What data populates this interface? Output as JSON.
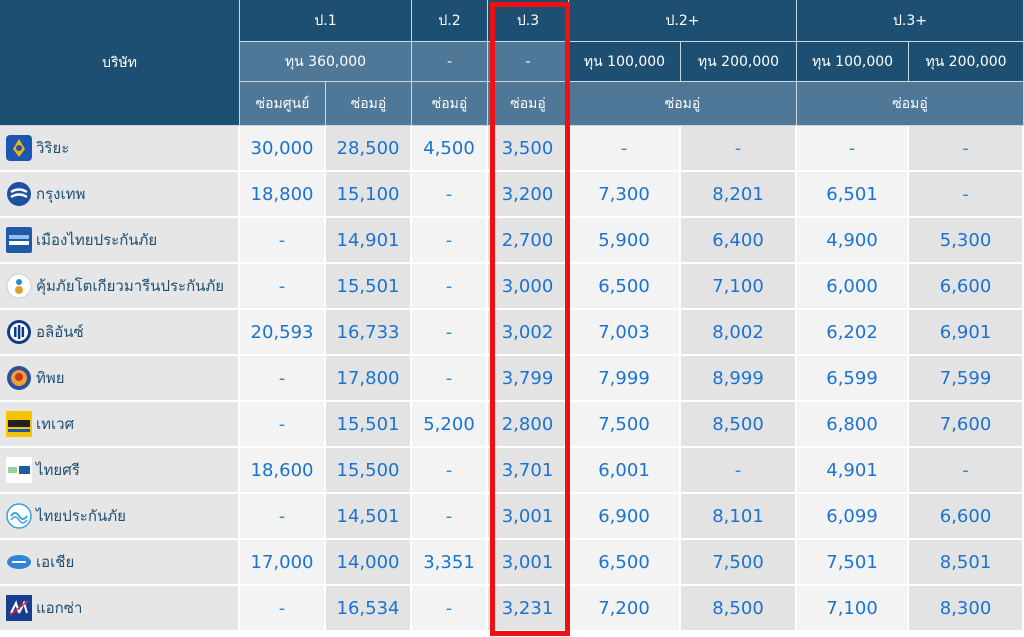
{
  "header": {
    "company_label": "บริษัท",
    "groups": [
      {
        "label": "ป.1",
        "span": 2
      },
      {
        "label": "ป.2",
        "span": 1
      },
      {
        "label": "ป.3",
        "span": 1
      },
      {
        "label": "ป.2+",
        "span": 2
      },
      {
        "label": "ป.3+",
        "span": 2
      }
    ],
    "sums": [
      {
        "label": "ทุน 360,000",
        "span": 2
      },
      {
        "label": "-",
        "span": 1
      },
      {
        "label": "-",
        "span": 1
      },
      {
        "label": "ทุน 100,000",
        "span": 1
      },
      {
        "label": "ทุน 200,000",
        "span": 1
      },
      {
        "label": "ทุน 100,000",
        "span": 1
      },
      {
        "label": "ทุน 200,000",
        "span": 1
      }
    ],
    "repair": [
      {
        "label": "ซ่อมศูนย์",
        "span": 1
      },
      {
        "label": "ซ่อมอู่",
        "span": 1
      },
      {
        "label": "ซ่อมอู่",
        "span": 1
      },
      {
        "label": "ซ่อมอู่",
        "span": 1
      },
      {
        "label": "ซ่อมอู่",
        "span": 2
      },
      {
        "label": "ซ่อมอู่",
        "span": 2
      }
    ]
  },
  "rows": [
    {
      "company": "วิริยะ",
      "logo": "viriyah-logo",
      "values": [
        "30,000",
        "28,500",
        "4,500",
        "3,500",
        "-",
        "-",
        "-",
        "-"
      ]
    },
    {
      "company": "กรุงเทพ",
      "logo": "bangkok-insurance-logo",
      "values": [
        "18,800",
        "15,100",
        "-",
        "3,200",
        "7,300",
        "8,201",
        "6,501",
        "-"
      ]
    },
    {
      "company": "เมืองไทยประกันภัย",
      "logo": "muang-thai-logo",
      "values": [
        "-",
        "14,901",
        "-",
        "2,700",
        "5,900",
        "6,400",
        "4,900",
        "5,300"
      ]
    },
    {
      "company": "คุ้มภัยโตเกียวมารีนประกันภัย",
      "logo": "tokio-marine-logo",
      "values": [
        "-",
        "15,501",
        "-",
        "3,000",
        "6,500",
        "7,100",
        "6,000",
        "6,600"
      ]
    },
    {
      "company": "อลิอันซ์",
      "logo": "allianz-logo",
      "values": [
        "20,593",
        "16,733",
        "-",
        "3,002",
        "7,003",
        "8,002",
        "6,202",
        "6,901"
      ]
    },
    {
      "company": "ทิพย",
      "logo": "dhipaya-logo",
      "values": [
        "-",
        "17,800",
        "-",
        "3,799",
        "7,999",
        "8,999",
        "6,599",
        "7,599"
      ]
    },
    {
      "company": "เทเวศ",
      "logo": "deves-logo",
      "values": [
        "-",
        "15,501",
        "5,200",
        "2,800",
        "7,500",
        "8,500",
        "6,800",
        "7,600"
      ]
    },
    {
      "company": "ไทยศรี",
      "logo": "thaisri-logo",
      "values": [
        "18,600",
        "15,500",
        "-",
        "3,701",
        "6,001",
        "-",
        "4,901",
        "-"
      ]
    },
    {
      "company": "ไทยประกันภัย",
      "logo": "thai-insurance-logo",
      "values": [
        "-",
        "14,501",
        "-",
        "3,001",
        "6,900",
        "8,101",
        "6,099",
        "6,600"
      ]
    },
    {
      "company": "เอเชีย",
      "logo": "asia-insurance-logo",
      "values": [
        "17,000",
        "14,000",
        "3,351",
        "3,001",
        "6,500",
        "7,500",
        "7,501",
        "8,501"
      ]
    },
    {
      "company": "แอกซ่า",
      "logo": "axa-logo",
      "values": [
        "-",
        "16,534",
        "-",
        "3,231",
        "7,200",
        "8,500",
        "7,100",
        "8,300"
      ]
    }
  ],
  "colors": {
    "header_dark": "#1d4f73",
    "header_mid": "#4f7898",
    "value_blue": "#1a73d1",
    "highlight_red": "#ee1111"
  }
}
